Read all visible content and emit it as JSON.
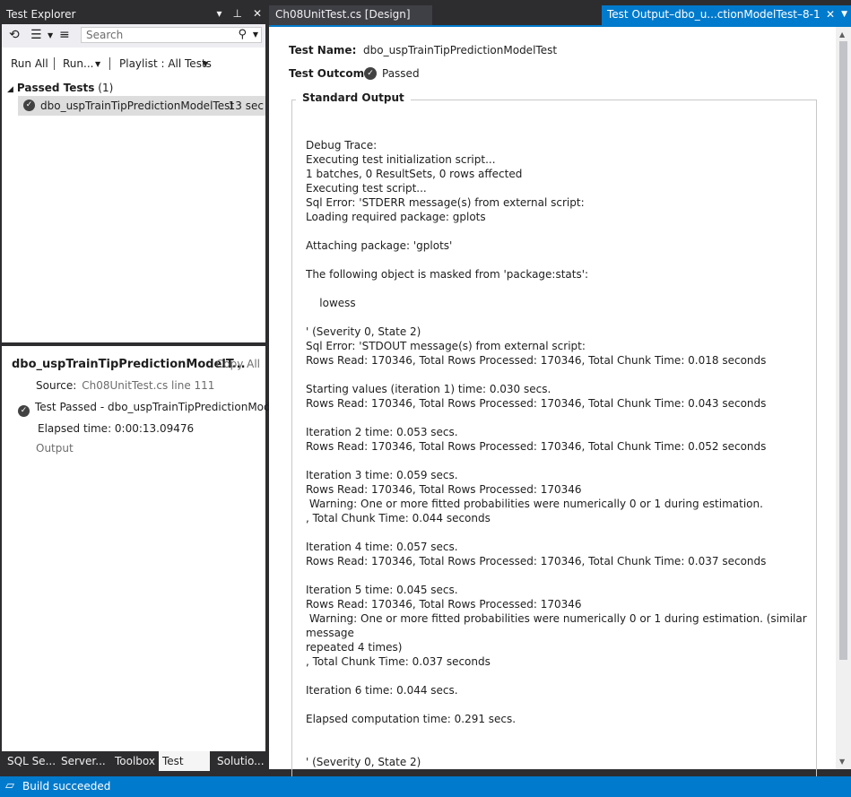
{
  "test_explorer": {
    "title": "Test Explorer",
    "title_buttons": [
      "▾",
      "⊥",
      "✕"
    ],
    "search_placeholder": "Search",
    "toolbar": {
      "run_all": "Run All",
      "run": "Run...",
      "playlist": "Playlist : All Tests"
    },
    "group": {
      "label": "Passed Tests",
      "count": "(1)"
    },
    "test": {
      "name": "dbo_uspTrainTipPredictionModelTest",
      "time": "13 sec"
    },
    "detail": {
      "title": "dbo_uspTrainTipPredictionModelT...",
      "copy_all": "Copy All",
      "source_label": "Source:",
      "source_link": "Ch08UnitTest.cs line 111",
      "status": "Test Passed - dbo_uspTrainTipPredictionModelT",
      "elapsed": "Elapsed time: 0:00:13.09476",
      "output_link": "Output"
    },
    "bottom_tabs": [
      "SQL Se...",
      "Server...",
      "Toolbox",
      "Test Ex...",
      "Solutio..."
    ]
  },
  "tabs": {
    "design": "Ch08UnitTest.cs [Design]",
    "output": "Test Output–dbo_u...ctionModelTest–8-1"
  },
  "test_output": {
    "name_label": "Test Name:",
    "name_value": "dbo_uspTrainTipPredictionModelTest",
    "outcome_label": "Test Outcome:",
    "outcome_value": "Passed",
    "standard_output_label": "Standard Output",
    "standard_output": "Debug Trace:\nExecuting test initialization script...\n1 batches, 0 ResultSets, 0 rows affected\nExecuting test script...\nSql Error: 'STDERR message(s) from external script:\nLoading required package: gplots\n\nAttaching package: 'gplots'\n\nThe following object is masked from 'package:stats':\n\n    lowess\n\n' (Severity 0, State 2)\nSql Error: 'STDOUT message(s) from external script:\nRows Read: 170346, Total Rows Processed: 170346, Total Chunk Time: 0.018 seconds\n\nStarting values (iteration 1) time: 0.030 secs.\nRows Read: 170346, Total Rows Processed: 170346, Total Chunk Time: 0.043 seconds\n\nIteration 2 time: 0.053 secs.\nRows Read: 170346, Total Rows Processed: 170346, Total Chunk Time: 0.052 seconds\n\nIteration 3 time: 0.059 secs.\nRows Read: 170346, Total Rows Processed: 170346\n Warning: One or more fitted probabilities were numerically 0 or 1 during estimation.\n, Total Chunk Time: 0.044 seconds\n\nIteration 4 time: 0.057 secs.\nRows Read: 170346, Total Rows Processed: 170346, Total Chunk Time: 0.037 seconds\n\nIteration 5 time: 0.045 secs.\nRows Read: 170346, Total Rows Processed: 170346\n Warning: One or more fitted probabilities were numerically 0 or 1 during estimation. (similar message\nrepeated 4 times)\n, Total Chunk Time: 0.037 seconds\n\nIteration 6 time: 0.044 secs.\n\nElapsed computation time: 0.291 secs.\n\n\n' (Severity 0, State 2)\nSql Error: 'STDOUT message(s) from external script:"
  },
  "status_bar": {
    "text": "Build succeeded"
  }
}
